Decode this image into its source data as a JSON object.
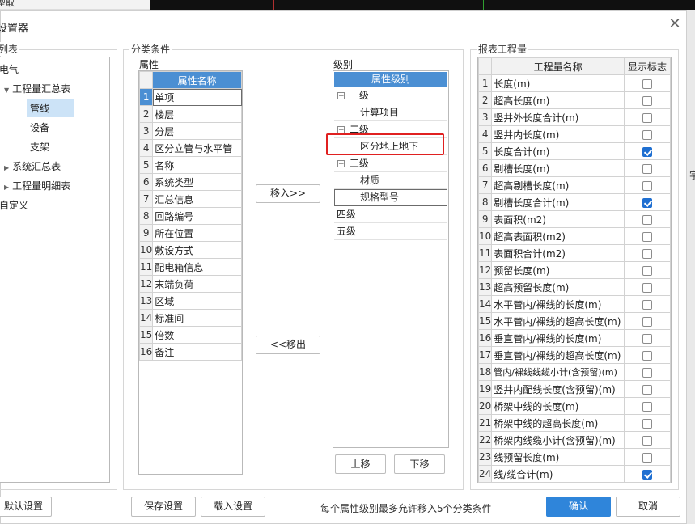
{
  "window": {
    "title": "设置器",
    "top_strip_text": "型取",
    "right_edge_text": "字"
  },
  "left": {
    "group_label": "列表",
    "tree": [
      {
        "label": "电气"
      },
      {
        "label": "工程量汇总表"
      },
      {
        "label": "管线"
      },
      {
        "label": "设备"
      },
      {
        "label": "支架"
      },
      {
        "label": "系统汇总表"
      },
      {
        "label": "工程量明细表"
      },
      {
        "label": "自定义"
      }
    ]
  },
  "classify": {
    "group_label": "分类条件",
    "attr_label": "属性",
    "attr_header": "属性名称",
    "attributes": [
      "单项",
      "楼层",
      "分层",
      "区分立管与水平管",
      "名称",
      "系统类型",
      "汇总信息",
      "回路编号",
      "所在位置",
      "敷设方式",
      "配电箱信息",
      "末端负荷",
      "区域",
      "标准间",
      "倍数",
      "备注"
    ],
    "level_label": "级别",
    "level_header": "属性级别",
    "levels": [
      {
        "label": "一级",
        "children": [
          "计算项目"
        ]
      },
      {
        "label": "二级",
        "children": [
          "区分地上地下"
        ]
      },
      {
        "label": "三级",
        "children": [
          "材质",
          "规格型号"
        ]
      },
      {
        "label": "四级",
        "children": []
      },
      {
        "label": "五级",
        "children": []
      }
    ],
    "move_in": "移入>>",
    "move_out": "<<移出",
    "up": "上移",
    "down": "下移"
  },
  "report": {
    "group_label": "报表工程量",
    "col_name": "工程量名称",
    "col_show": "显示标志",
    "rows": [
      {
        "name": "长度(m)",
        "show": false
      },
      {
        "name": "超高长度(m)",
        "show": false
      },
      {
        "name": "竖井外长度合计(m)",
        "show": false
      },
      {
        "name": "竖井内长度(m)",
        "show": false
      },
      {
        "name": "长度合计(m)",
        "show": true
      },
      {
        "name": "剔槽长度(m)",
        "show": false
      },
      {
        "name": "超高剔槽长度(m)",
        "show": false
      },
      {
        "name": "剔槽长度合计(m)",
        "show": true
      },
      {
        "name": "表面积(m2)",
        "show": false
      },
      {
        "name": "超高表面积(m2)",
        "show": false
      },
      {
        "name": "表面积合计(m2)",
        "show": false
      },
      {
        "name": "预留长度(m)",
        "show": false
      },
      {
        "name": "超高预留长度(m)",
        "show": false
      },
      {
        "name": "水平管内/裸线的长度(m)",
        "show": false
      },
      {
        "name": "水平管内/裸线的超高长度(m)",
        "show": false
      },
      {
        "name": "垂直管内/裸线的长度(m)",
        "show": false
      },
      {
        "name": "垂直管内/裸线的超高长度(m)",
        "show": false
      },
      {
        "name": "管内/裸线线缆小计(含预留)(m)",
        "show": false
      },
      {
        "name": "竖井内配线长度(含预留)(m)",
        "show": false
      },
      {
        "name": "桥架中线的长度(m)",
        "show": false
      },
      {
        "name": "桥架中线的超高长度(m)",
        "show": false
      },
      {
        "name": "桥架内线缆小计(含预留)(m)",
        "show": false
      },
      {
        "name": "线预留长度(m)",
        "show": false
      },
      {
        "name": "线/缆合计(m)",
        "show": true
      }
    ]
  },
  "footer": {
    "default_settings": "默认设置",
    "save_settings": "保存设置",
    "load_settings": "载入设置",
    "hint": "每个属性级别最多允许移入5个分类条件",
    "ok": "确认",
    "cancel": "取消"
  },
  "colors": {
    "accent": "#4b8fd3",
    "primary_button": "#2f85da",
    "highlight_box": "#e02020"
  }
}
